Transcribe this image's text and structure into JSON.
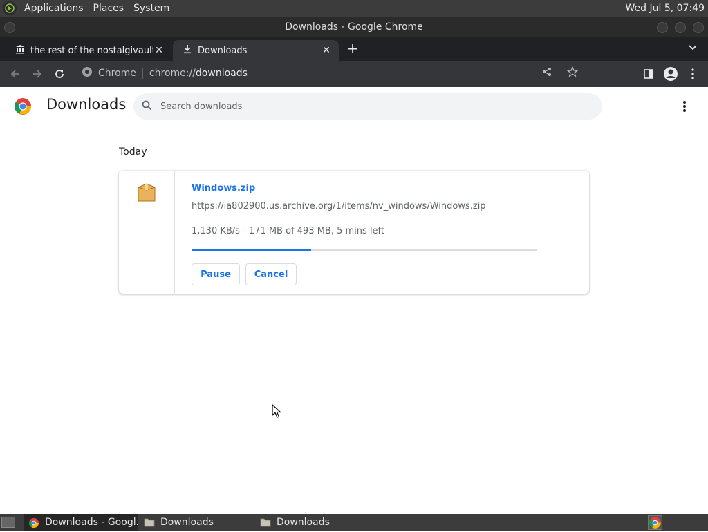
{
  "top_panel": {
    "menus": [
      "Applications",
      "Places",
      "System"
    ],
    "clock": "Wed Jul  5, 07:49"
  },
  "window": {
    "title": "Downloads - Google Chrome"
  },
  "tabs": [
    {
      "title": "the rest of the nostalgivault fil",
      "icon": "archive-museum-icon",
      "active": false
    },
    {
      "title": "Downloads",
      "icon": "download-icon",
      "active": true
    }
  ],
  "toolbar": {
    "site_label": "Chrome",
    "url_scheme": "chrome://",
    "url_host": "downloads"
  },
  "page": {
    "title": "Downloads",
    "search_placeholder": "Search downloads",
    "section_label": "Today",
    "download": {
      "file_name": "Windows.zip",
      "url": "https://ia802900.us.archive.org/1/items/nv_windows/Windows.zip",
      "status": "1,130 KB/s - 171 MB of 493 MB, 5 mins left",
      "progress_fraction": 0.347,
      "pause_label": "Pause",
      "cancel_label": "Cancel"
    }
  },
  "taskbar": {
    "tasks": [
      "Downloads - Googl...",
      "Downloads",
      "Downloads"
    ]
  },
  "colors": {
    "accent": "#1a73e8",
    "panel_bg": "#3c3c3c",
    "tab_strip_bg": "#202124",
    "toolbar_bg": "#35363a"
  }
}
